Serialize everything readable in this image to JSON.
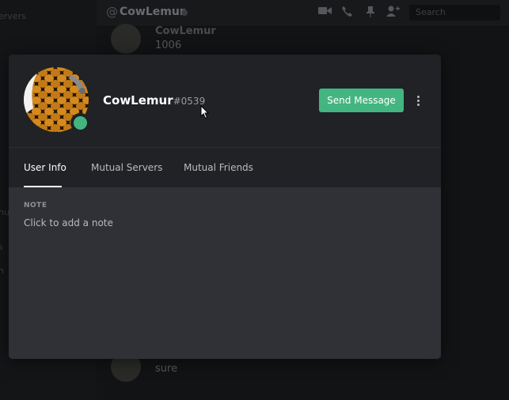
{
  "background": {
    "left_faint": [
      "ervers",
      "nu",
      "s",
      "n"
    ],
    "header": {
      "hash_icon": "hash-icon",
      "channel": "CowLemur",
      "search_placeholder": "Search"
    },
    "messages": [
      {
        "name": "CowLemur",
        "text": "1006"
      },
      {
        "text": "sure"
      }
    ]
  },
  "profile": {
    "username": "CowLemur",
    "discriminator": "#0539",
    "status": "online",
    "status_color": "#43b581",
    "send_message_label": "Send Message",
    "more_icon": "more-vertical-icon"
  },
  "tabs": [
    {
      "label": "User Info",
      "active": true
    },
    {
      "label": "Mutual Servers",
      "active": false
    },
    {
      "label": "Mutual Friends",
      "active": false
    }
  ],
  "note": {
    "label": "NOTE",
    "placeholder": "Click to add a note"
  }
}
